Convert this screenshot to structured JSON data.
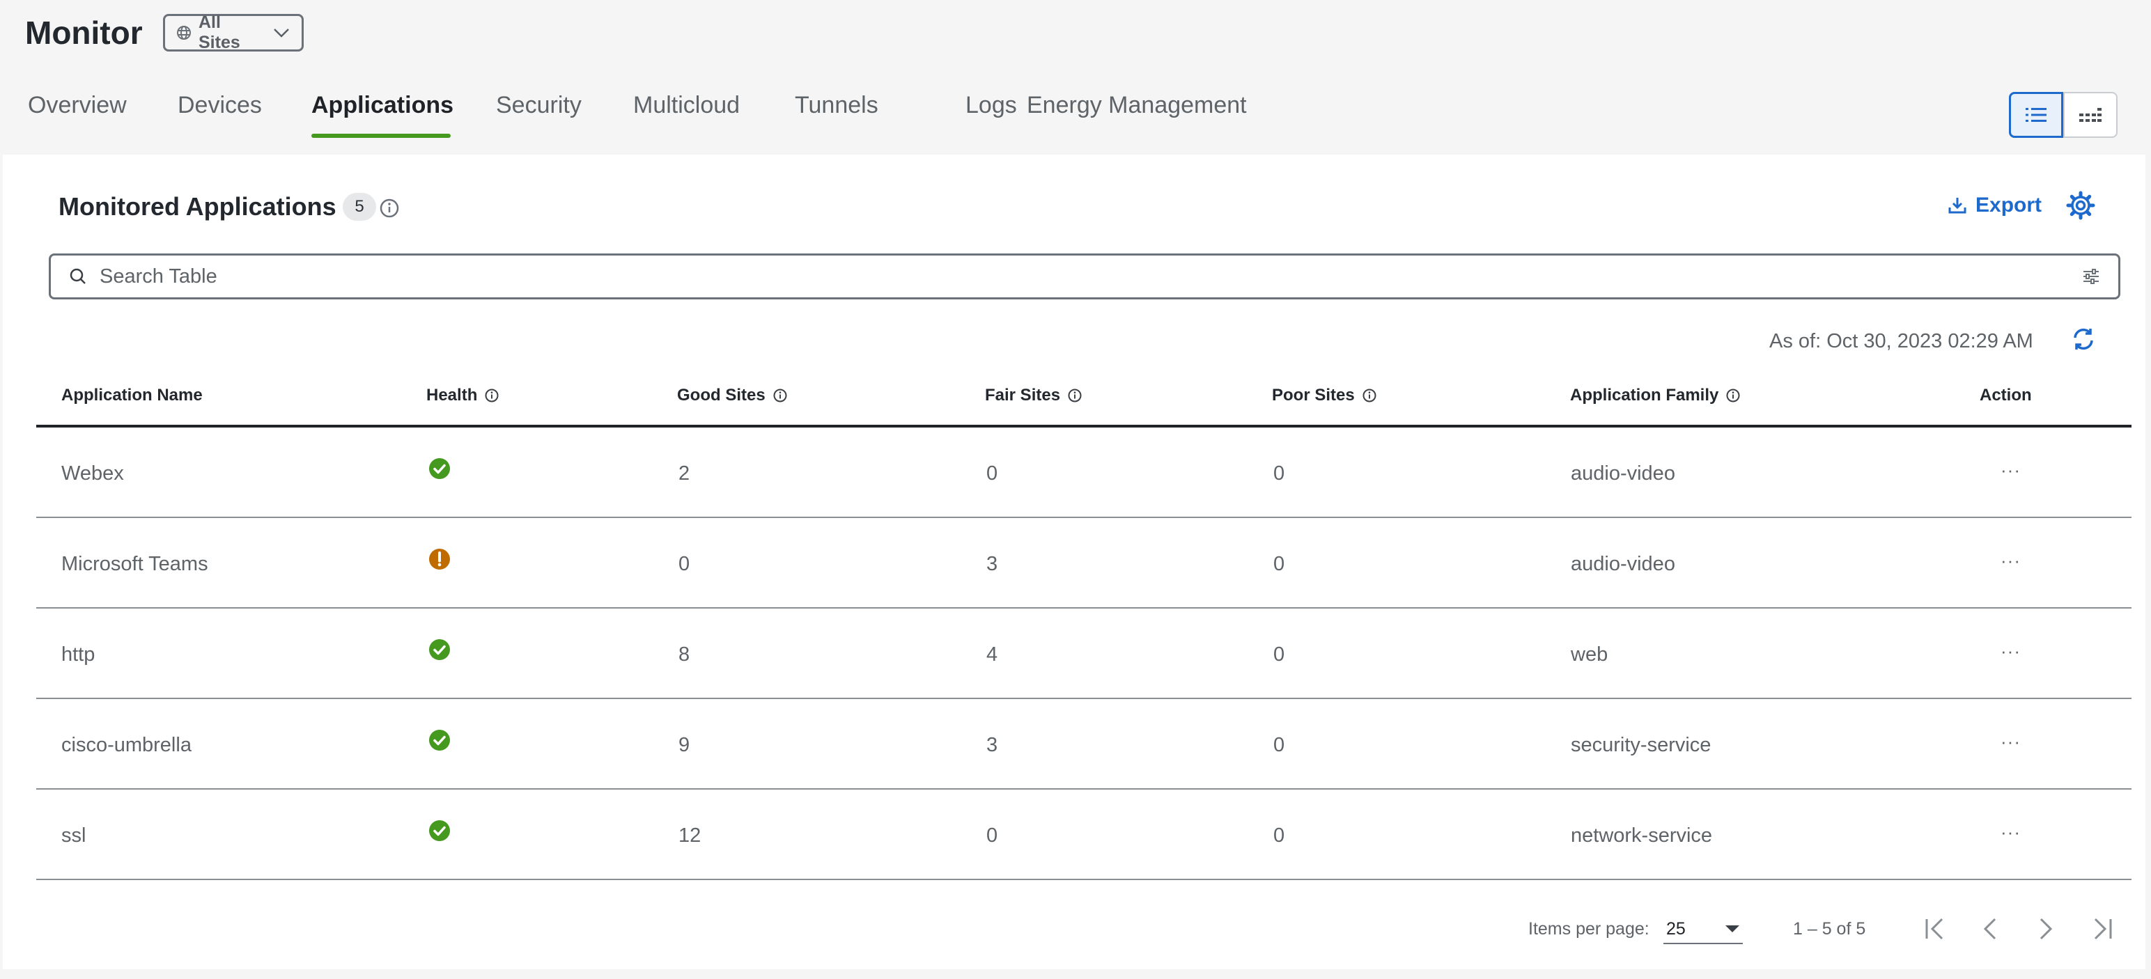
{
  "header": {
    "title": "Monitor",
    "site_selector": "All Sites",
    "tabs": [
      {
        "label": "Overview"
      },
      {
        "label": "Devices"
      },
      {
        "label": "Applications",
        "active": true
      },
      {
        "label": "Security"
      },
      {
        "label": "Multicloud"
      },
      {
        "label": "Tunnels"
      },
      {
        "label": "Logs"
      },
      {
        "label": "Energy Management"
      }
    ],
    "view_toggle": {
      "selected": "list"
    }
  },
  "panel": {
    "title": "Monitored Applications",
    "count": "5",
    "export_label": "Export",
    "search": {
      "placeholder": "Search Table",
      "value": ""
    },
    "as_of": "As of: Oct 30, 2023 02:29 AM"
  },
  "table": {
    "columns": [
      "Application Name",
      "Health",
      "Good Sites",
      "Fair Sites",
      "Poor Sites",
      "Application Family",
      "Action"
    ],
    "rows": [
      {
        "name": "Webex",
        "health": "good",
        "good": "2",
        "fair": "0",
        "poor": "0",
        "family": "audio-video",
        "action": "···"
      },
      {
        "name": "Microsoft Teams",
        "health": "fair",
        "good": "0",
        "fair": "3",
        "poor": "0",
        "family": "audio-video",
        "action": "···"
      },
      {
        "name": "http",
        "health": "good",
        "good": "8",
        "fair": "4",
        "poor": "0",
        "family": "web",
        "action": "···"
      },
      {
        "name": "cisco-umbrella",
        "health": "good",
        "good": "9",
        "fair": "3",
        "poor": "0",
        "family": "security-service",
        "action": "···"
      },
      {
        "name": "ssl",
        "health": "good",
        "good": "12",
        "fair": "0",
        "poor": "0",
        "family": "network-service",
        "action": "···"
      }
    ]
  },
  "pagination": {
    "items_per_page_label": "Items per page:",
    "items_per_page": "25",
    "range": "1 – 5 of 5"
  },
  "colors": {
    "accent": "#1d69cc",
    "tab_indicator": "#45991f",
    "health_good": "#45991f",
    "health_fair": "#c06b00"
  },
  "icons": {
    "site_selector": "globe-icon",
    "info": "info-icon",
    "export": "download-icon",
    "settings": "gear-icon",
    "search": "search-icon",
    "filter": "filter-sliders-icon",
    "refresh": "refresh-icon",
    "health_good": "check-circle-icon",
    "health_fair": "warning-circle-icon"
  }
}
